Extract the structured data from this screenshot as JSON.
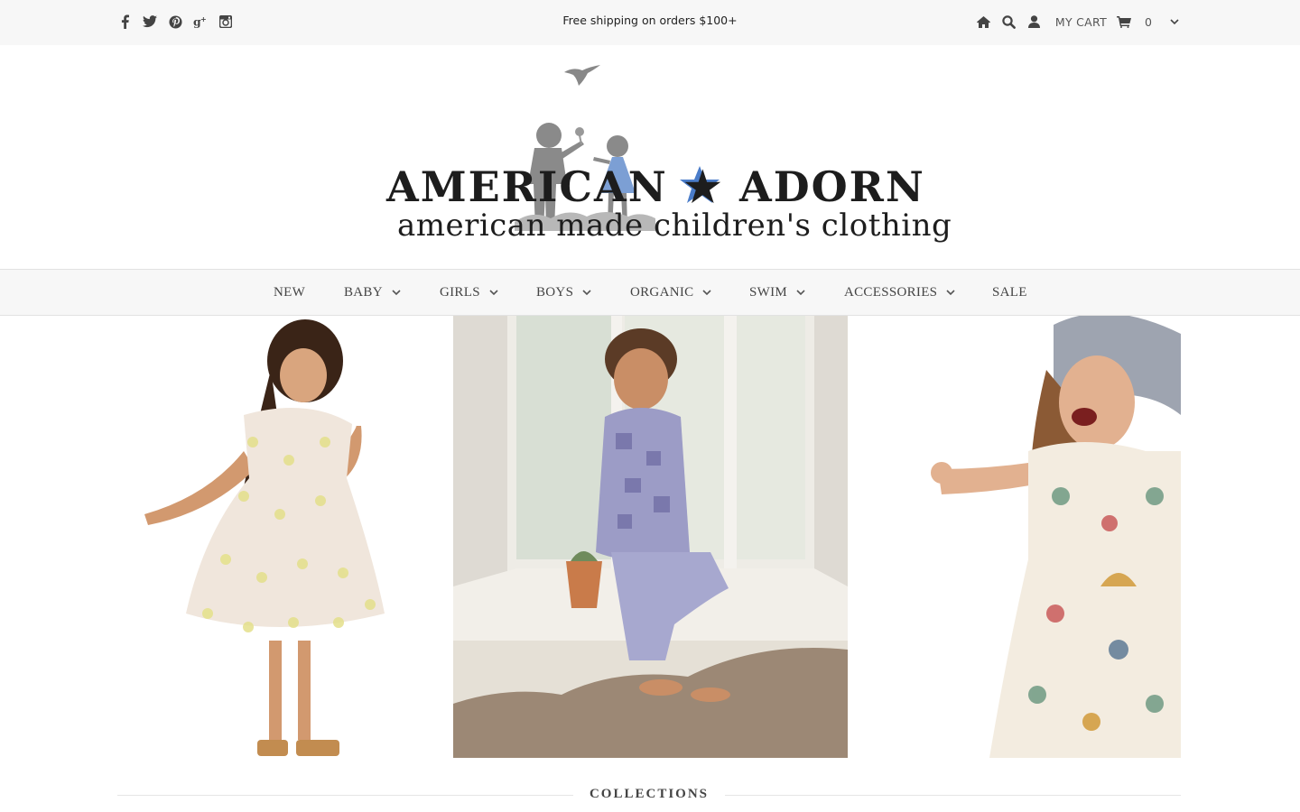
{
  "topbar": {
    "promo": "Free shipping on orders $100+",
    "social_icons": [
      "facebook-icon",
      "twitter-icon",
      "pinterest-icon",
      "google-plus-icon",
      "instagram-icon"
    ],
    "tool_icons": [
      "home-icon",
      "search-icon",
      "user-icon"
    ],
    "cart_label": "MY CART",
    "cart_count": "0"
  },
  "logo": {
    "title": "AMERICAN ★ ADORN",
    "subtitle": "american made children's clothing"
  },
  "nav": {
    "items": [
      {
        "label": "NEW",
        "dropdown": false
      },
      {
        "label": "BABY",
        "dropdown": true
      },
      {
        "label": "GIRLS",
        "dropdown": true
      },
      {
        "label": "BOYS",
        "dropdown": true
      },
      {
        "label": "ORGANIC",
        "dropdown": true
      },
      {
        "label": "SWIM",
        "dropdown": true
      },
      {
        "label": "ACCESSORIES",
        "dropdown": true
      },
      {
        "label": "SALE",
        "dropdown": false
      }
    ]
  },
  "sections": {
    "collections_title": "COLLECTIONS"
  },
  "colors": {
    "topbar_bg": "#f7f7f7",
    "star_blue": "#4a7cc9",
    "text_dark": "#222222"
  }
}
